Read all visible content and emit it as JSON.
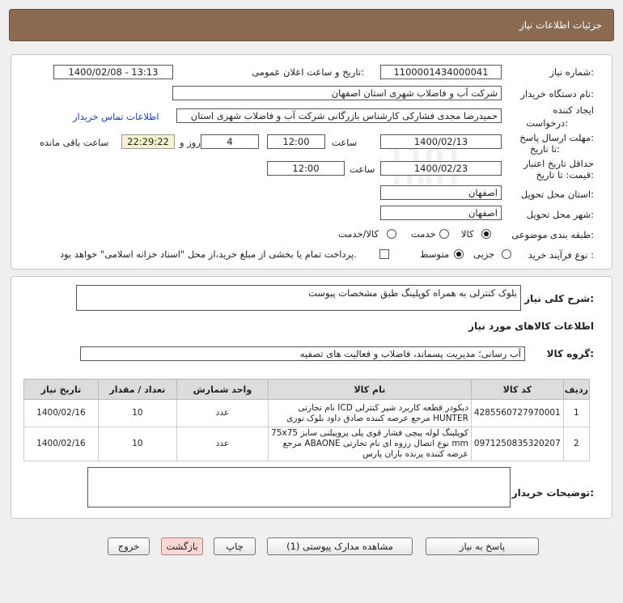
{
  "header": {
    "title": "جزئیات اطلاعات نیاز"
  },
  "form": {
    "need_number_label": "شماره نیاز:",
    "need_number": "1100001434000041",
    "announce_label": "تاریخ و ساعت اعلان عمومی:",
    "announce_value": "1400/02/08 - 13:13",
    "buyer_org_label": "نام دستگاه خریدار:",
    "buyer_org": "شرکت آب و فاضلاب شهری استان اصفهان",
    "creator_label_1": "ایجاد کننده",
    "creator_label_2": "درخواست:",
    "creator": "حمیدرضا مجدی فشارکی کارشناس بازرگانی شرکت آب و فاضلاب شهری استان",
    "contact_link": "اطلاعات تماس خریدار",
    "deadline_label_1": "مهلت ارسال پاسخ:",
    "deadline_label_2": "تا تاریخ:",
    "deadline_date": "1400/02/13",
    "time_label": "ساعت",
    "deadline_time": "12:00",
    "day_and_label": "روز و",
    "days_left": "4",
    "remaining_time": "22:29:22",
    "remaining_label": "ساعت باقی مانده",
    "validity_label_1": "حداقل تاریخ اعتبار",
    "validity_label_2": "قیمت: تا تاریخ:",
    "validity_date": "1400/02/23",
    "validity_time": "12:00",
    "province_label": "استان محل تحویل:",
    "province": "اصفهان",
    "city_label": "شهر محل تحویل:",
    "city": "اصفهان",
    "category_label": "طبقه بندی موضوعی:",
    "category_options": [
      "کالا",
      "خدمت",
      "کالا/خدمت"
    ],
    "category_selected": 0,
    "process_label": "نوع فرآیند خرید :",
    "process_options": [
      "جزیی",
      "متوسط"
    ],
    "process_selected": 1,
    "payment_note": "پرداخت تمام یا بخشی از مبلغ خرید،از محل \"اسناد خزانه اسلامی\" خواهد بود."
  },
  "summary": {
    "desc_label": "شرح کلی نیاز:",
    "desc": "بلوک کنترلی به همراه کوپلینگ طبق مشخصات پیوست",
    "goods_info_title": "اطلاعات کالاهای مورد نیاز",
    "group_label": "گروه کالا:",
    "group": "آب رسانی؛ مدیریت پسماند، فاضلاب و فعالیت های تصفیه"
  },
  "table": {
    "headers": [
      "ردیف",
      "کد کالا",
      "نام کالا",
      "واحد شمارش",
      "تعداد / مقدار",
      "تاریخ نیاز"
    ],
    "rows": [
      {
        "idx": "1",
        "code": "4285560727970001",
        "name": "دیکودر قطعه کاربرد شیر کنترلی ICD نام تجارتی HUNTER مرجع عرضه کننده صادق داود بلوک نوری",
        "unit": "عدد",
        "qty": "10",
        "date": "1400/02/16"
      },
      {
        "idx": "2",
        "code": "0971250835320207",
        "name": "کوپلینگ لوله پیچی فشار قوی پلی پروپیلنی سایز 75x75 mm نوع اتصال رزوه ای نام تجارتی ABAONE مرجع عرضه کننده پرنده باران پارس",
        "unit": "عدد",
        "qty": "10",
        "date": "1400/02/16"
      }
    ]
  },
  "buyer_notes": {
    "label": "توضیحات خریدار:",
    "value": ""
  },
  "buttons": {
    "reply": "پاسخ به نیاز",
    "attachments": "مشاهده مدارک پیوستی (1)",
    "print": "چاپ",
    "back": "بازگشت",
    "exit": "خروج"
  },
  "watermark": {
    "brand": "ParsNamadData",
    "digits": "1101 1001 1800"
  },
  "colors": {
    "header_bg": "#8b6a52",
    "link": "#1a3fcc",
    "timer_bg": "#f6f2cf",
    "back_btn": "#f9d7d4"
  }
}
